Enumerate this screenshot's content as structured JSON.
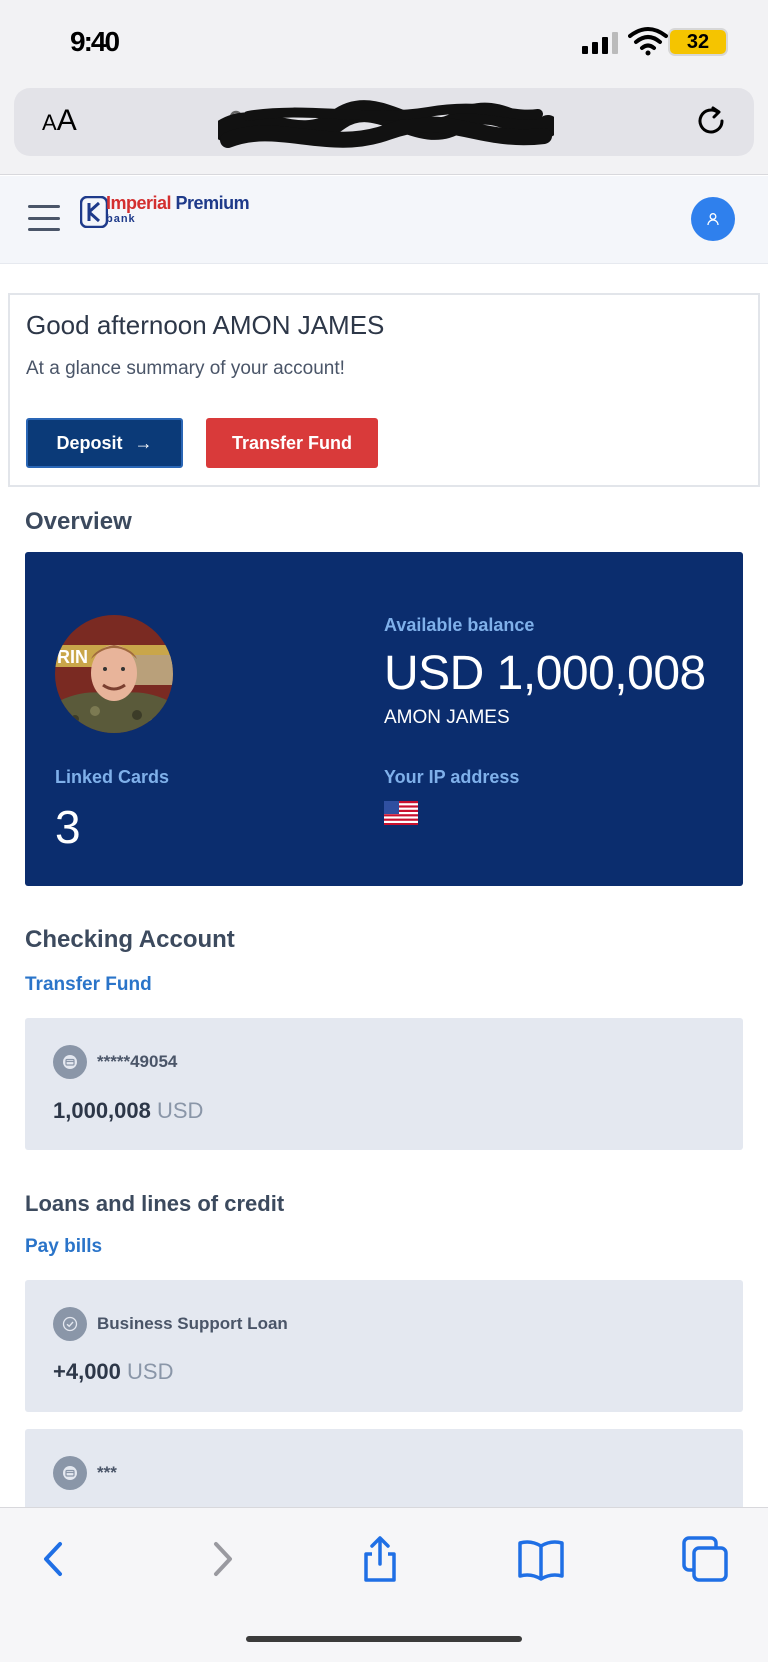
{
  "status_bar": {
    "time": "9:40",
    "battery": "32"
  },
  "browser": {
    "text_size_label_small": "A",
    "text_size_label_large": "A"
  },
  "header": {
    "logo": {
      "name_part1": "Imperial",
      "name_part2": "Premium",
      "subtitle": "bank"
    }
  },
  "greeting": {
    "title": "Good afternoon AMON JAMES",
    "subtitle": "At a glance summary of your account!",
    "deposit_label": "Deposit",
    "deposit_arrow": "→",
    "transfer_label": "Transfer Fund"
  },
  "overview": {
    "heading": "Overview",
    "available_label": "Available balance",
    "balance": "USD 1,000,008",
    "account_name": "AMON JAMES",
    "linked_cards_label": "Linked Cards",
    "linked_cards_count": "3",
    "ip_label": "Your IP address",
    "ip_flag_icon": "us-flag-icon"
  },
  "checking": {
    "heading": "Checking Account",
    "link": "Transfer Fund",
    "account_number": "*****49054",
    "amount": "1,000,008",
    "currency": "USD"
  },
  "loans": {
    "heading": "Loans and lines of credit",
    "link": "Pay bills",
    "items": [
      {
        "label": "Business Support Loan",
        "amount": "+4,000",
        "currency": "USD",
        "icon": "check-circle-icon"
      },
      {
        "label": "***",
        "icon": "card-icon"
      }
    ]
  },
  "toolbar": {
    "icons": [
      "back-icon",
      "forward-icon",
      "share-icon",
      "bookmarks-icon",
      "tabs-icon"
    ]
  },
  "colors": {
    "brand_navy": "#0b2d6e",
    "deposit_blue": "#0b3a78",
    "transfer_red": "#d93a3a",
    "link_blue": "#2a74c9",
    "avatar_blue": "#2f80ed"
  }
}
